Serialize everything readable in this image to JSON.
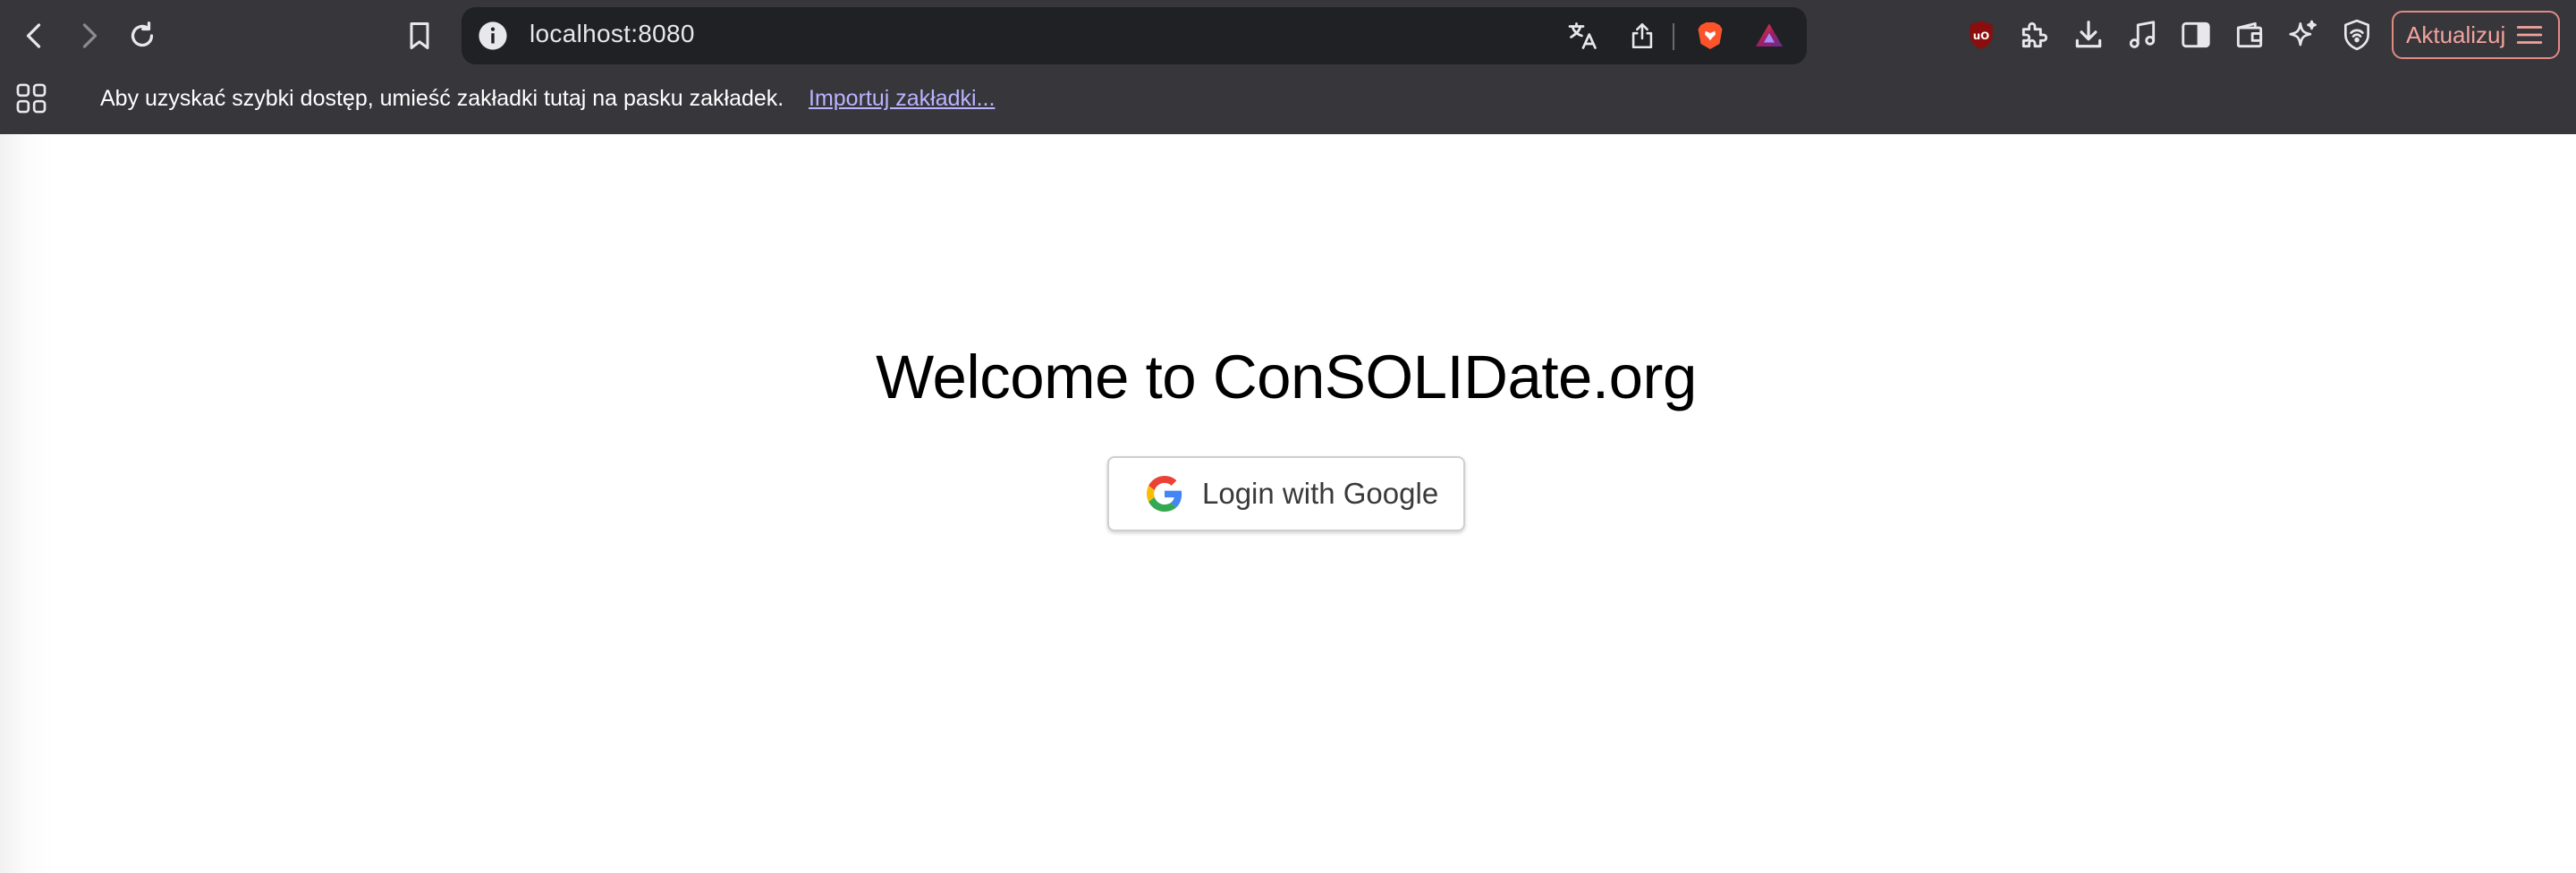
{
  "browser": {
    "address": "localhost:8080",
    "update_label": "Aktualizuj",
    "accent": "#e28b85"
  },
  "bookmarks_bar": {
    "hint": "Aby uzyskać szybki dostęp, umieść zakładki tutaj na pasku zakładek.",
    "import_link": "Importuj zakładki..."
  },
  "page": {
    "title": "Welcome to ConSOLIDate.org",
    "login_button": "Login with Google"
  },
  "icons": {
    "back": "arrow-left-icon",
    "forward": "arrow-right-icon",
    "reload": "reload-icon",
    "bookmark": "bookmark-icon",
    "info": "info-icon",
    "translate": "translate-icon",
    "share": "share-icon",
    "brave": "brave-shield-icon",
    "rewards": "brave-rewards-icon",
    "ublock": "ublock-icon",
    "extensions": "puzzle-icon",
    "downloads": "download-icon",
    "media": "music-note-icon",
    "sidebar": "sidebar-icon",
    "wallet": "wallet-icon",
    "leo": "sparkle-icon",
    "vpn": "vpn-icon",
    "menu": "hamburger-icon",
    "apps": "apps-grid-icon",
    "google": "google-g-icon"
  },
  "colors": {
    "chrome_bg": "#36363b",
    "urlbar_bg": "#202124",
    "link": "#b9b4ff",
    "brave_orange": "#fb542b"
  }
}
